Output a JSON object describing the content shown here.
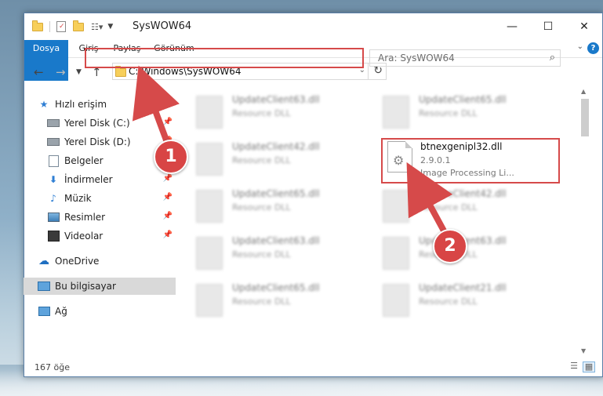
{
  "window": {
    "title": "SysWOW64",
    "controls": {
      "minimize": "—",
      "maximize": "☐",
      "close": "✕"
    }
  },
  "ribbon": {
    "tabs": [
      "Dosya",
      "Giriş",
      "Paylaş",
      "Görünüm"
    ],
    "help": "?"
  },
  "address": {
    "path": "C:\\Windows\\SysWOW64"
  },
  "search": {
    "placeholder": "Ara: SysWOW64"
  },
  "sidebar": {
    "items": [
      {
        "label": "Hızlı erişim",
        "icon": "star-icon",
        "pinned": false
      },
      {
        "label": "Yerel Disk (C:)",
        "icon": "drive-icon",
        "pinned": true
      },
      {
        "label": "Yerel Disk (D:)",
        "icon": "drive-icon",
        "pinned": true
      },
      {
        "label": "Belgeler",
        "icon": "documents-icon",
        "pinned": true
      },
      {
        "label": "İndirmeler",
        "icon": "download-icon",
        "pinned": true
      },
      {
        "label": "Müzik",
        "icon": "music-icon",
        "pinned": true
      },
      {
        "label": "Resimler",
        "icon": "pictures-icon",
        "pinned": true
      },
      {
        "label": "Videolar",
        "icon": "video-icon",
        "pinned": true
      },
      {
        "label": "OneDrive",
        "icon": "cloud-icon",
        "pinned": false
      },
      {
        "label": "Bu bilgisayar",
        "icon": "computer-icon",
        "pinned": false
      },
      {
        "label": "Ağ",
        "icon": "network-icon",
        "pinned": false
      }
    ]
  },
  "files": {
    "blurred": [
      {
        "name": "UpdateClient63.dll",
        "desc": "Resource DLL"
      },
      {
        "name": "UpdateClient65.dll",
        "desc": "Resource DLL"
      },
      {
        "name": "UpdateClient42.dll",
        "desc": "Resource DLL"
      },
      {
        "name": "UpdateClient65.dll",
        "desc": "Resource DLL"
      },
      {
        "name": "UpdateClient42.dll",
        "desc": "Resource DLL"
      },
      {
        "name": "UpdateClient63.dll",
        "desc": "Resource DLL"
      },
      {
        "name": "UpdateClient63.dll",
        "desc": "Resource DLL"
      },
      {
        "name": "UpdateClient65.dll",
        "desc": "Resource DLL"
      },
      {
        "name": "UpdateClient21.dll",
        "desc": "Resource DLL"
      }
    ],
    "highlighted": {
      "name": "btnexgenipl32.dll",
      "version": "2.9.0.1",
      "description": "Image Processing Li..."
    }
  },
  "status": {
    "count": "167 öğe"
  },
  "annotations": {
    "step1": "1",
    "step2": "2",
    "color": "#d64a4a"
  }
}
